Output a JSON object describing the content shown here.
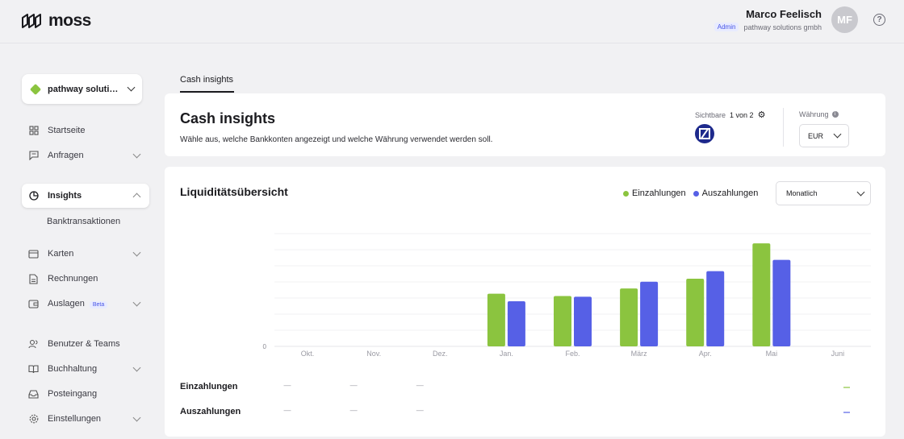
{
  "app": {
    "brand": "moss"
  },
  "user": {
    "name": "Marco Feelisch",
    "role_badge": "Admin",
    "company": "pathway solutions gmbh",
    "initials": "MF"
  },
  "sidebar": {
    "org_label": "pathway soluti…",
    "items": [
      {
        "label": "Startseite"
      },
      {
        "label": "Anfragen"
      },
      {
        "label": "Insights"
      },
      {
        "label": "Banktransaktionen"
      },
      {
        "label": "Karten"
      },
      {
        "label": "Rechnungen"
      },
      {
        "label": "Auslagen",
        "badge": "Beta"
      },
      {
        "label": "Benutzer & Teams"
      },
      {
        "label": "Buchhaltung"
      },
      {
        "label": "Posteingang"
      },
      {
        "label": "Einstellungen"
      }
    ]
  },
  "tabs": {
    "active": "Cash insights"
  },
  "header_card": {
    "title": "Cash insights",
    "description": "Wähle aus, welche Bankkonten angezeigt und welche Währung verwendet werden soll.",
    "visible_label": "Sichtbare",
    "visible_count": "1 von 2",
    "currency_label": "Währung",
    "currency_value": "EUR"
  },
  "chart_card": {
    "title": "Liquiditätsübersicht",
    "period": "Monatlich",
    "row_in": "Einzahlungen",
    "row_out": "Auszahlungen",
    "dash": "—"
  },
  "colors": {
    "green": "#8bc43f",
    "blue": "#5660e6"
  },
  "chart_data": {
    "type": "bar",
    "categories": [
      "Okt.",
      "Nov.",
      "Dez.",
      "Jan.",
      "Feb.",
      "März",
      "Apr.",
      "Mai",
      "Juni"
    ],
    "y_tick_labels": [
      "0"
    ],
    "series": [
      {
        "name": "Einzahlungen",
        "values": [
          0,
          0,
          0,
          70,
          67,
          77,
          90,
          137,
          0
        ]
      },
      {
        "name": "Auszahlungen",
        "values": [
          0,
          0,
          0,
          60,
          66,
          86,
          100,
          115,
          0
        ]
      }
    ],
    "ymax": 150,
    "grid": true,
    "legend": "top-right"
  }
}
